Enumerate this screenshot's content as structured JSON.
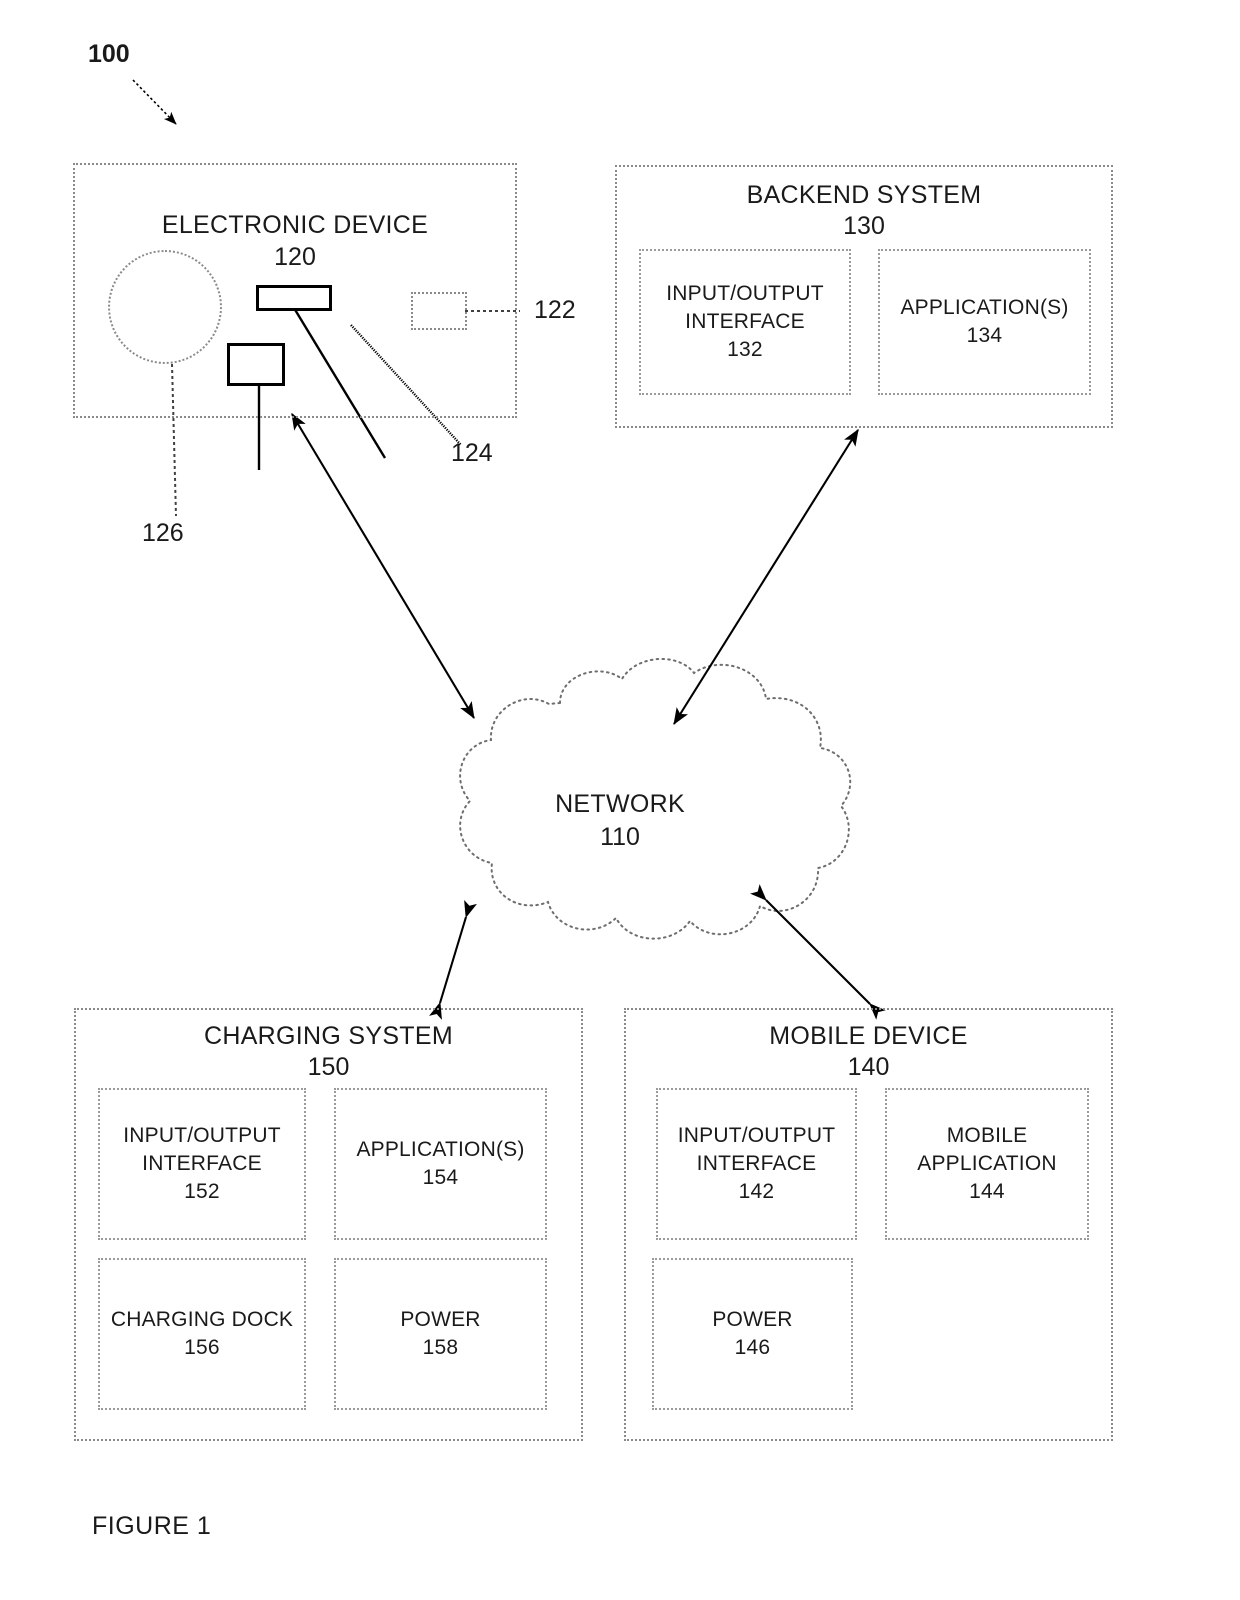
{
  "figure": {
    "caption": "FIGURE 1",
    "system_ref": "100"
  },
  "nodes": {
    "electronic_device": {
      "title": "ELECTRONIC DEVICE",
      "ref": "120",
      "callouts": [
        {
          "ref": "122",
          "name": "sensor-module-callout"
        },
        {
          "ref": "124",
          "name": "antenna-callout"
        },
        {
          "ref": "126",
          "name": "body-callout"
        }
      ]
    },
    "backend_system": {
      "title": "BACKEND SYSTEM",
      "ref": "130",
      "components": [
        {
          "label_line1": "INPUT/OUTPUT",
          "label_line2": "INTERFACE",
          "ref": "132"
        },
        {
          "label_line1": "APPLICATION(S)",
          "label_line2": "",
          "ref": "134"
        }
      ]
    },
    "network": {
      "title": "NETWORK",
      "ref": "110"
    },
    "charging_system": {
      "title": "CHARGING SYSTEM",
      "ref": "150",
      "components": [
        {
          "label_line1": "INPUT/OUTPUT",
          "label_line2": "INTERFACE",
          "ref": "152"
        },
        {
          "label_line1": "APPLICATION(S)",
          "label_line2": "",
          "ref": "154"
        },
        {
          "label_line1": "CHARGING DOCK",
          "label_line2": "",
          "ref": "156"
        },
        {
          "label_line1": "POWER",
          "label_line2": "",
          "ref": "158"
        }
      ]
    },
    "mobile_device": {
      "title": "MOBILE DEVICE",
      "ref": "140",
      "components": [
        {
          "label_line1": "INPUT/OUTPUT",
          "label_line2": "INTERFACE",
          "ref": "142"
        },
        {
          "label_line1": "MOBILE",
          "label_line2": "APPLICATION",
          "ref": "144"
        },
        {
          "label_line1": "POWER",
          "label_line2": "",
          "ref": "146"
        }
      ]
    }
  },
  "connections": [
    {
      "name": "electronic-device-to-network",
      "from": "electronic_device",
      "to": "network",
      "style": "double-arrow"
    },
    {
      "name": "backend-system-to-network",
      "from": "backend_system",
      "to": "network",
      "style": "double-arrow"
    },
    {
      "name": "charging-system-to-network",
      "from": "charging_system",
      "to": "network",
      "style": "double-arrow"
    },
    {
      "name": "mobile-device-to-network",
      "from": "mobile_device",
      "to": "network",
      "style": "double-arrow"
    }
  ],
  "colors": {
    "line": "#000000",
    "dotted_border": "#8a8a8a",
    "text": "#1a1a1a",
    "background": "#ffffff"
  }
}
